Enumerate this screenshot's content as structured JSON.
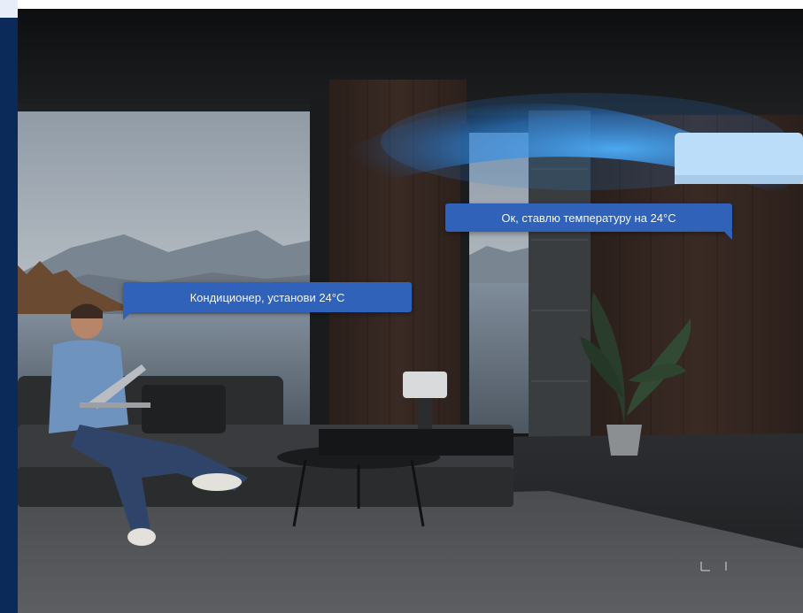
{
  "speech_bubbles": {
    "user_command": "Кондиционер, установи 24°C",
    "assistant_reply": "Ок, ставлю температуру на 24°C"
  },
  "scene": {
    "description_icons": [
      "air-conditioner-icon",
      "sofa-icon",
      "laptop-icon",
      "plant-icon",
      "lamp-icon",
      "coffee-table-icon"
    ]
  },
  "colors": {
    "bubble": "#2f62b8",
    "side_strip": "#0b2a5a",
    "airflow": "#3ea6ff"
  }
}
